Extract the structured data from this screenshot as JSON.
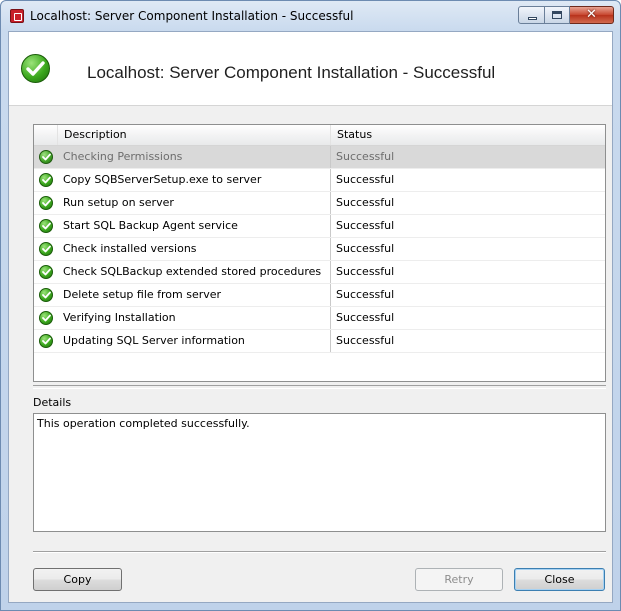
{
  "window": {
    "title": "Localhost: Server Component Installation - Successful",
    "app_icon": "red-gate-app-icon",
    "caption_buttons": {
      "minimize": "minimize-icon",
      "maximize": "maximize-icon",
      "close": "close-icon",
      "close_glyph": "✕"
    }
  },
  "header": {
    "icon": "success-check-icon",
    "title": "Localhost: Server Component Installation - Successful"
  },
  "table": {
    "columns": {
      "icon": "",
      "description": "Description",
      "status": "Status"
    },
    "rows": [
      {
        "icon": "success-check-icon",
        "description": "Checking Permissions",
        "status": "Successful",
        "selected": true
      },
      {
        "icon": "success-check-icon",
        "description": "Copy SQBServerSetup.exe to server",
        "status": "Successful",
        "selected": false
      },
      {
        "icon": "success-check-icon",
        "description": "Run setup on server",
        "status": "Successful",
        "selected": false
      },
      {
        "icon": "success-check-icon",
        "description": "Start SQL Backup Agent service",
        "status": "Successful",
        "selected": false
      },
      {
        "icon": "success-check-icon",
        "description": "Check installed versions",
        "status": "Successful",
        "selected": false
      },
      {
        "icon": "success-check-icon",
        "description": "Check SQLBackup extended stored procedures",
        "status": "Successful",
        "selected": false
      },
      {
        "icon": "success-check-icon",
        "description": "Delete setup file from server",
        "status": "Successful",
        "selected": false
      },
      {
        "icon": "success-check-icon",
        "description": "Verifying Installation",
        "status": "Successful",
        "selected": false
      },
      {
        "icon": "success-check-icon",
        "description": "Updating SQL Server information",
        "status": "Successful",
        "selected": false
      }
    ]
  },
  "details": {
    "label": "Details",
    "text": "This operation completed successfully."
  },
  "buttons": {
    "copy": "Copy",
    "retry": "Retry",
    "close": "Close"
  },
  "colors": {
    "success_green": "#3ca81e",
    "selected_row": "#d9d9d9",
    "window_frame": "#bfd2ea"
  }
}
